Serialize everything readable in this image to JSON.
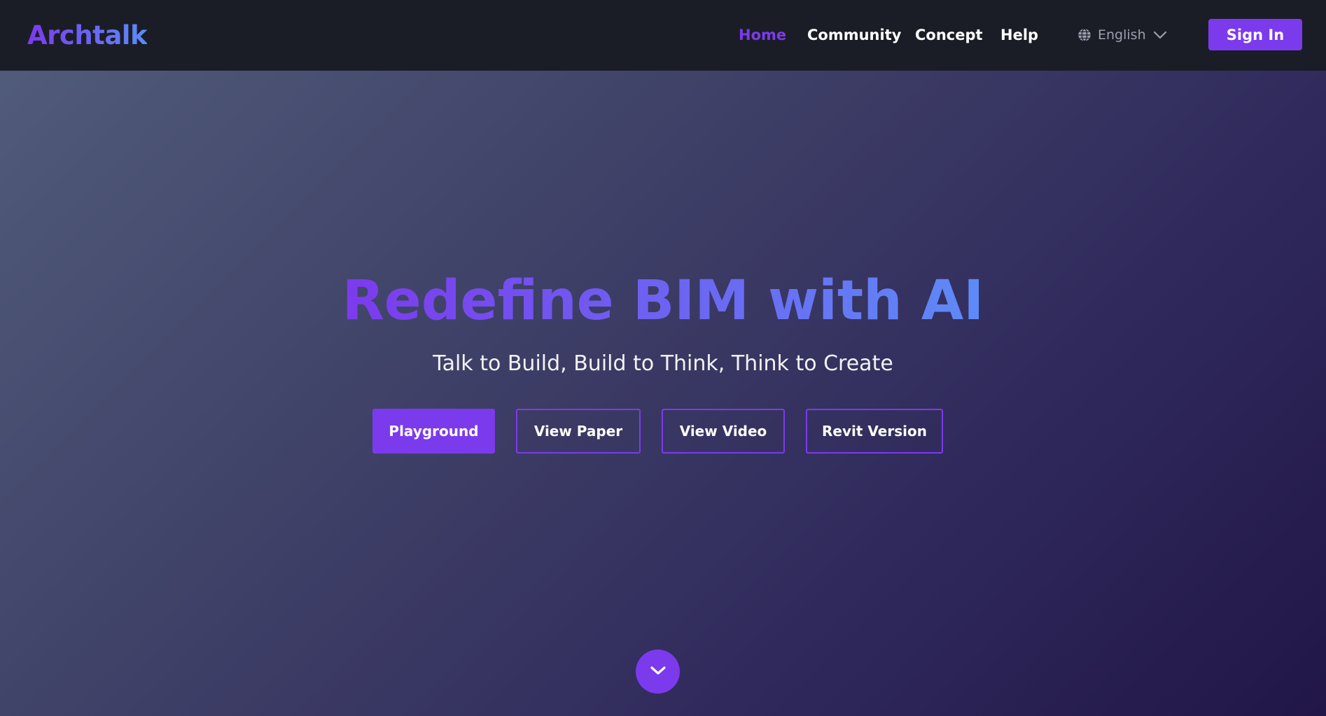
{
  "brand": {
    "logo_text": "Archtalk"
  },
  "nav": {
    "links": [
      {
        "label": "Home",
        "active": true
      },
      {
        "label": "Community",
        "active": false
      },
      {
        "label": "Concept",
        "active": false
      },
      {
        "label": "Help",
        "active": false
      }
    ],
    "language": {
      "selected": "English",
      "icon": "globe-icon",
      "dropdown_icon": "chevron-down-icon"
    },
    "signin_label": "Sign In"
  },
  "hero": {
    "title": "Redefine BIM with AI",
    "subtitle": "Talk to Build, Build to Think, Think to Create",
    "buttons": [
      {
        "label": "Playground",
        "style": "primary"
      },
      {
        "label": "View Paper",
        "style": "outline"
      },
      {
        "label": "View Video",
        "style": "outline"
      },
      {
        "label": "Revit Version",
        "style": "outline"
      }
    ],
    "scroll_icon": "chevron-down-icon"
  },
  "colors": {
    "accent": "#7c3aed",
    "accent_blue": "#5e8bf7",
    "navbar_bg": "#1b1d26",
    "text_light": "#ffffff",
    "muted": "#9aa0ad"
  }
}
